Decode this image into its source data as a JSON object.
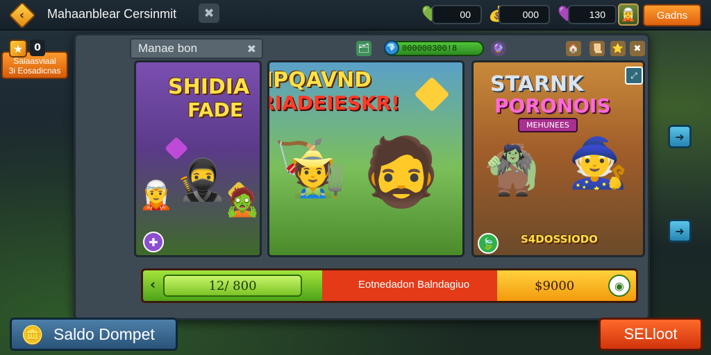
{
  "topbar": {
    "title": "Mahaanblear Cersinmit",
    "currencies": [
      {
        "icon": "heart-gem-icon",
        "value": "00"
      },
      {
        "icon": "treasure-bag-icon",
        "value": "000"
      },
      {
        "icon": "purple-gem-icon",
        "value": "130"
      }
    ],
    "deals_label": "Gadns"
  },
  "left_promo": {
    "line1": "Saiaasviaal",
    "line2": "3i Eosadicnas"
  },
  "modal": {
    "star_count": "0",
    "tab_label": "Manae bon",
    "progress_value": "000000300!8",
    "cards": [
      {
        "title_line1": "SHIDIA",
        "title_line2": "FADE"
      },
      {
        "title_line1": "IPQAVND",
        "title_line2": "RIADEIESKR!"
      },
      {
        "title_line1": "STARNK",
        "title_line2": "PORONOIS",
        "subtitle": "MEHUNEES",
        "price": "S4DOSSIODO"
      }
    ],
    "bottom_bar": {
      "left_value": "12/ 800",
      "middle_text": "Eotnedadon Balndagiuo",
      "right_value": "$9000"
    }
  },
  "bottom": {
    "wallet_label": "Saldo Dompet",
    "sell_label": "SELloot"
  },
  "colors": {
    "accent_orange": "#e0620e",
    "accent_green": "#4ea31a",
    "accent_red": "#e53a18",
    "accent_blue": "#2a5379"
  }
}
